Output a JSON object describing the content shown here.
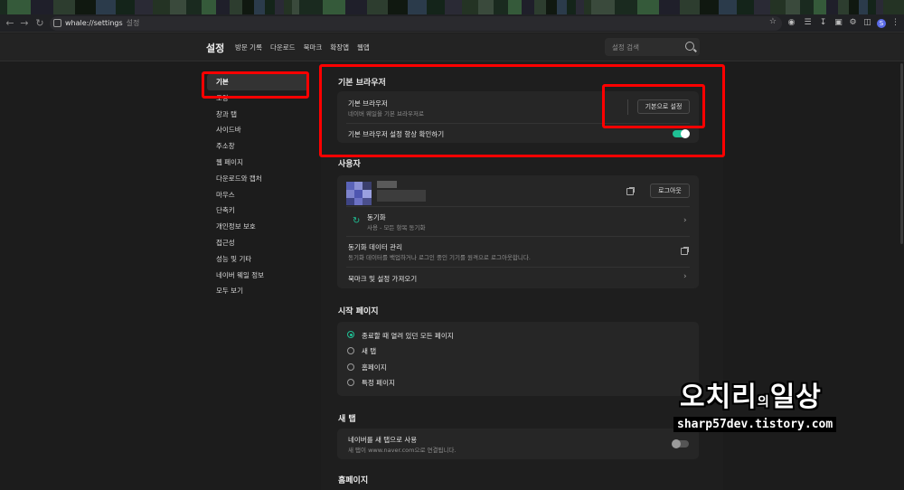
{
  "browser": {
    "url": "whale://settings",
    "url_suffix": "설정"
  },
  "header": {
    "title": "설정",
    "links": [
      "방문 기록",
      "다운로드",
      "북마크",
      "확장앱",
      "웹앱"
    ],
    "search_placeholder": "설정 검색"
  },
  "sidebar": {
    "items": [
      {
        "label": "기본",
        "active": true
      },
      {
        "label": "모양"
      },
      {
        "label": "창과 탭"
      },
      {
        "label": "사이드바"
      },
      {
        "label": "주소창"
      },
      {
        "label": "웹 페이지"
      },
      {
        "label": "다운로드와 캡처"
      },
      {
        "label": "마우스"
      },
      {
        "label": "단축키"
      },
      {
        "label": "개인정보 보호"
      },
      {
        "label": "접근성"
      },
      {
        "label": "성능 및 기타"
      },
      {
        "label": "네이버 웨일 정보"
      },
      {
        "label": "모두 보기"
      }
    ]
  },
  "default_browser": {
    "title": "기본 브라우저",
    "row_title": "기본 브라우저",
    "row_sub": "네이버 웨일을 기본 브라우저로",
    "set_default_button": "기본으로 설정",
    "always_check_label": "기본 브라우저 설정 항상 확인하기",
    "always_check_on": true
  },
  "user": {
    "title": "사용자",
    "logout_button": "로그아웃",
    "sync_title": "동기화",
    "sync_sub": "사용 - 모든 항목 동기화",
    "sync_data_title": "동기화 데이터 관리",
    "sync_data_sub": "동기화 데이터를 백업하거나 로그인 중인 기기를 원격으로 로그아웃합니다.",
    "import_label": "북마크 및 설정 가져오기"
  },
  "start_page": {
    "title": "시작 페이지",
    "options": [
      {
        "label": "종료할 때 열려 있던 모든 페이지",
        "selected": true
      },
      {
        "label": "새 탭"
      },
      {
        "label": "홈페이지"
      },
      {
        "label": "특정 페이지"
      }
    ]
  },
  "new_tab": {
    "title": "새 탭",
    "row_title": "네이버를 새 탭으로 사용",
    "row_sub": "새 탭이 www.naver.com으로 연결됩니다.",
    "enabled": false
  },
  "homepage": {
    "title": "홈페이지"
  },
  "watermark": {
    "name_part1": "오치리",
    "name_mid": "의",
    "name_part2": "일상",
    "url": "sharp57dev.tistory.com"
  },
  "colors": {
    "accent": "#1fc195",
    "highlight": "#ff0000"
  }
}
